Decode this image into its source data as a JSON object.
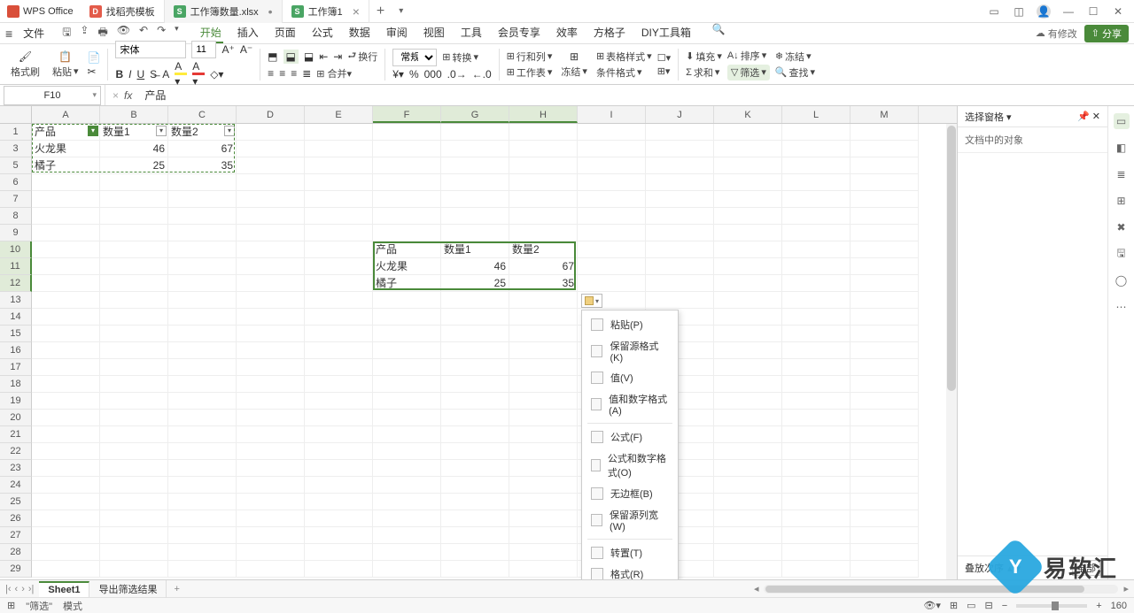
{
  "app": {
    "name": "WPS Office"
  },
  "tabs": [
    {
      "label": "找稻壳模板",
      "iconColor": "red"
    },
    {
      "label": "工作簿数量.xlsx",
      "iconColor": "green",
      "active": true,
      "dirty": true
    },
    {
      "label": "工作簿1",
      "iconColor": "green"
    }
  ],
  "menubar": {
    "file": "文件",
    "items": [
      "开始",
      "插入",
      "页面",
      "公式",
      "数据",
      "审阅",
      "视图",
      "工具",
      "会员专享",
      "效率",
      "方格子",
      "DIY工具箱"
    ],
    "active": "开始",
    "hasChanges": "有修改",
    "share": "分享"
  },
  "ribbon": {
    "formatBrush": "格式刷",
    "paste": "粘贴",
    "fontName": "宋体",
    "fontSize": "11",
    "wrap": "换行",
    "normal": "常规",
    "convert": "转换",
    "rowsCols": "行和列",
    "worksheet": "工作表",
    "freeze": "冻结",
    "tableStyle": "表格样式",
    "condFmt": "条件格式",
    "fill": "填充",
    "sort": "排序",
    "sum": "求和",
    "filter": "筛选",
    "find": "查找"
  },
  "formulaBar": {
    "nameBox": "F10",
    "value": "产品"
  },
  "columns": [
    "A",
    "B",
    "C",
    "D",
    "E",
    "F",
    "G",
    "H",
    "I",
    "J",
    "K",
    "L",
    "M"
  ],
  "rowsVisible": [
    1,
    3,
    5,
    6,
    7,
    8,
    9,
    10,
    11,
    12,
    13,
    14,
    15,
    16,
    17,
    18,
    19,
    20,
    21,
    22,
    23,
    24,
    25,
    26,
    27,
    28,
    29
  ],
  "colWidths": {
    "A": 77,
    "B": 77,
    "C": 77,
    "D": 77,
    "E": 77,
    "F": 77,
    "G": 77,
    "H": 77,
    "I": 77,
    "J": 77,
    "K": 77,
    "L": 77,
    "M": 77
  },
  "sourceData": {
    "range": "A1:C5",
    "headers": [
      "产品",
      "数量1",
      "数量2"
    ],
    "rows": [
      {
        "product": "火龙果",
        "qty1": 46,
        "qty2": 67
      },
      {
        "product": "橘子",
        "qty1": 25,
        "qty2": 35
      }
    ]
  },
  "pasteData": {
    "range": "F10:H12",
    "headers": [
      "产品",
      "数量1",
      "数量2"
    ],
    "rows": [
      {
        "product": "火龙果",
        "qty1": 46,
        "qty2": 67
      },
      {
        "product": "橘子",
        "qty1": 25,
        "qty2": 35
      }
    ]
  },
  "pasteMenu": {
    "items": [
      {
        "label": "粘贴(P)"
      },
      {
        "label": "保留源格式(K)"
      },
      {
        "label": "值(V)"
      },
      {
        "label": "值和数字格式(A)"
      },
      {
        "sep": true
      },
      {
        "label": "公式(F)"
      },
      {
        "label": "公式和数字格式(O)"
      },
      {
        "label": "无边框(B)"
      },
      {
        "label": "保留源列宽(W)"
      },
      {
        "sep": true
      },
      {
        "label": "转置(T)"
      },
      {
        "label": "格式(R)"
      }
    ]
  },
  "panel": {
    "title": "选择窗格",
    "subtitle": "文档中的对象",
    "footer": "叠放次序",
    "footerBtn": "全部"
  },
  "sheets": {
    "tabs": [
      "Sheet1",
      "导出筛选结果"
    ],
    "active": "Sheet1"
  },
  "status": {
    "mode1": "\"筛选\"",
    "mode2": "模式",
    "zoom": "160"
  },
  "watermark": "易软汇"
}
